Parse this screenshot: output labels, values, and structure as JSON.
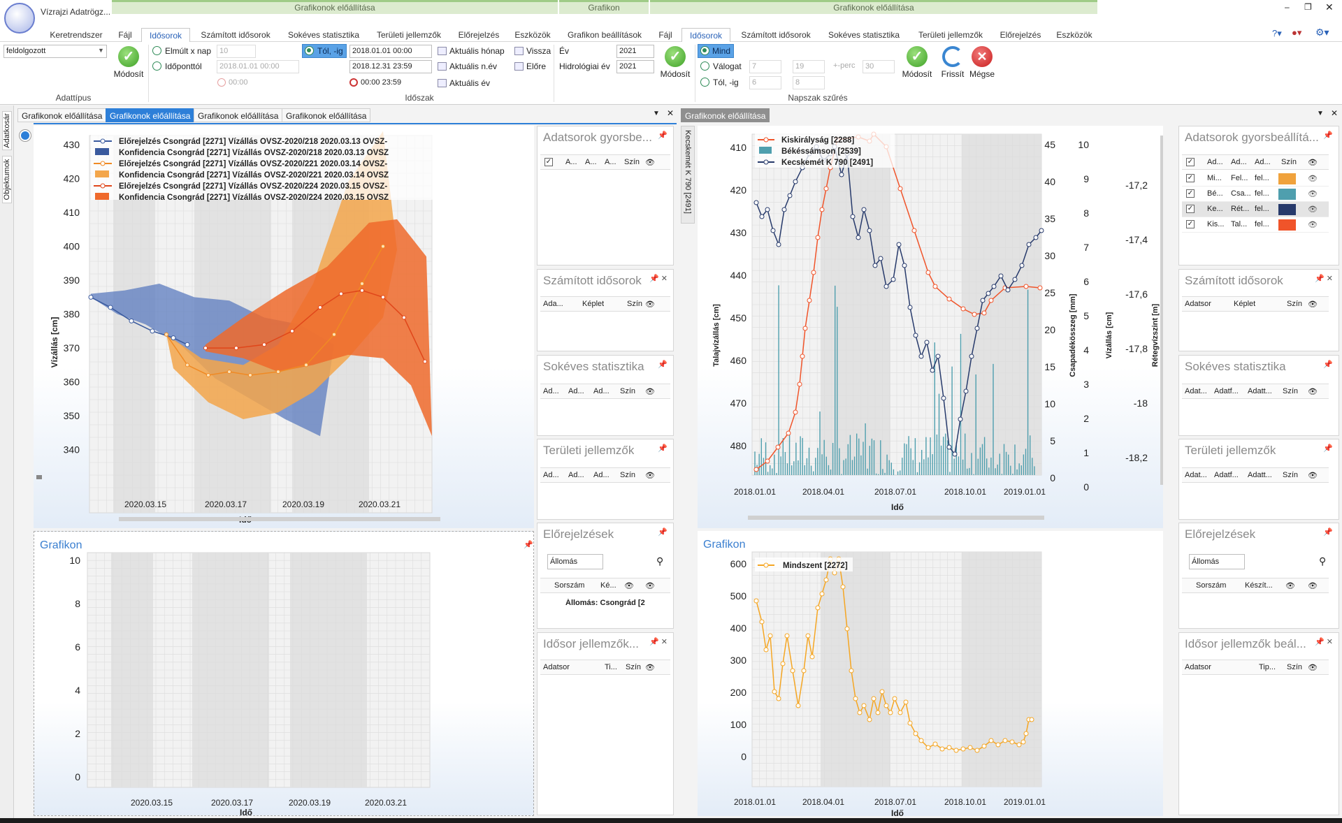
{
  "app": {
    "title": "Vízrajzi Adatrögz..."
  },
  "context_groups": [
    "Grafikonok előállítása",
    "Grafikon",
    "Grafikonok előállítása"
  ],
  "tabs_left": [
    "Keretrendszer",
    "Fájl",
    "Idősorok",
    "Számított idősorok",
    "Sokéves statisztika",
    "Területi jellemzők",
    "Előrejelzés",
    "Eszközök"
  ],
  "tabs_mid": [
    "Grafikon beállítások"
  ],
  "tabs_right": [
    "Fájl",
    "Idősorok",
    "Számított idősorok",
    "Sokéves statisztika",
    "Területi jellemzők",
    "Előrejelzés",
    "Eszközök"
  ],
  "ribbon": {
    "adattipus_value": "feldolgozott",
    "modosit": "Módosít",
    "group_adattipus": "Adattípus",
    "elmult_x_nap": "Elmúlt x nap",
    "elmult_value": "10",
    "idoponttol": "Időponttól",
    "idoponttol_value": "2018.01.01 00:00",
    "time_disabled": "00:00",
    "tol_ig": "Tól, -ig",
    "from_value": "2018.01.01 00:00",
    "to_value": "2018.12.31 23:59",
    "time_to": "00:00 23:59",
    "aktualis_honap": "Aktuális hónap",
    "aktualis_nev": "Aktuális n.év",
    "aktualis_ev": "Aktuális év",
    "vissza": "Vissza",
    "elore": "Előre",
    "group_idoszak": "Időszak",
    "ev": "Év",
    "ev_value": "2021",
    "hidro_ev": "Hidrológiai év",
    "hidro_value": "2021",
    "mind": "Mind",
    "valogat": "Válogat",
    "tol_ig2": "Tól, -ig",
    "val1": "7",
    "val2": "19",
    "perc_label": "+-perc",
    "perc_value": "30",
    "val3": "6",
    "val4": "8",
    "group_napszak": "Napszak szűrés",
    "frissit": "Frissít",
    "megse": "Mégse"
  },
  "side_tabs": [
    "Adatkosár",
    "Objektumok"
  ],
  "doc_tabs_left": [
    "Grafikonok előállítása",
    "Grafikonok előállítása",
    "Grafikonok előállítása",
    "Grafikonok előállítása"
  ],
  "doc_tabs_right": [
    "Grafikonok előállítása"
  ],
  "right_vertical_label": "Kecskemét K 790 [2491]",
  "chart1": {
    "legend": [
      "Előrejelzés Csongrád [2271] Vízállás OVSZ-2020/218 2020.03.13 OVSZ-",
      "Konfidencia Csongrád [2271] Vízállás OVSZ-2020/218 2020.03.13 OVSZ",
      "Előrejelzés Csongrád [2271] Vízállás OVSZ-2020/221 2020.03.14 OVSZ-",
      "Konfidencia Csongrád [2271] Vízállás OVSZ-2020/221 2020.03.14 OVSZ",
      "Előrejelzés Csongrád [2271] Vízállás OVSZ-2020/224 2020.03.15 OVSZ-",
      "Konfidencia Csongrád [2271] Vízállás OVSZ-2020/224 2020.03.15 OVSZ"
    ],
    "yticks": [
      "430",
      "420",
      "410",
      "400",
      "390",
      "380",
      "370",
      "360",
      "350",
      "340"
    ],
    "xticks": [
      "2020.03.15",
      "2020.03.17",
      "2020.03.19",
      "2020.03.21"
    ],
    "ylabel": "Vízállás [cm]",
    "xlabel": "Idő"
  },
  "chart2": {
    "title": "Grafikon",
    "yticks": [
      "10",
      "8",
      "6",
      "4",
      "2",
      "0"
    ],
    "xticks": [
      "2020.03.15",
      "2020.03.17",
      "2020.03.19",
      "2020.03.21"
    ],
    "xlabel": "Idő"
  },
  "chart3": {
    "legend": [
      "Kiskirályság [2288]",
      "Békéssámson [2539]",
      "Kecskemét K 790 [2491]"
    ],
    "y1ticks": [
      "410",
      "420",
      "430",
      "440",
      "450",
      "460",
      "470",
      "480"
    ],
    "y2ticks": [
      "45",
      "40",
      "35",
      "30",
      "25",
      "20",
      "15",
      "10",
      "5",
      "0"
    ],
    "y3ticks": [
      "10",
      "9",
      "8",
      "7",
      "6",
      "5",
      "4",
      "3",
      "2",
      "1",
      "0"
    ],
    "y4ticks": [
      "-17,2",
      "-17,4",
      "-17,6",
      "-17,8",
      "-18",
      "-18,2"
    ],
    "y1label": "Talajvízállás [cm]",
    "y2label": "Csapadékösszeg [mm]",
    "y3label": "Vízállás [cm]",
    "y4label": "Rétegvízszint [m]",
    "xticks": [
      "2018.01.01",
      "2018.04.01",
      "2018.07.01",
      "2018.10.01",
      "2019.01.01"
    ],
    "xlabel": "Idő"
  },
  "chart4": {
    "title": "Grafikon",
    "legend": [
      "Mindszent [2272]"
    ],
    "yticks": [
      "600",
      "500",
      "400",
      "300",
      "200",
      "100",
      "0"
    ],
    "xticks": [
      "2018.01.01",
      "2018.04.01",
      "2018.07.01",
      "2018.10.01",
      "2019.01.01"
    ],
    "xlabel": "Idő"
  },
  "side_left": {
    "gyors_title": "Adatsorok gyorsbe...",
    "gyors_cols": [
      "A...",
      "A...",
      "A...",
      "Szín"
    ],
    "szamitott_title": "Számított idősorok",
    "szamitott_cols": [
      "Ada...",
      "Képlet",
      "Szín"
    ],
    "sokeves_title": "Sokéves statisztika",
    "sokeves_cols": [
      "Ad...",
      "Ad...",
      "Ad...",
      "Szín"
    ],
    "teruleti_title": "Területi jellemzők",
    "teruleti_cols": [
      "Ad...",
      "Ad...",
      "Ad...",
      "Szín"
    ],
    "elorejelzes_title": "Előrejelzések",
    "allomas": "Állomás",
    "sorszam_cols": [
      "Sorszám",
      "Ké..."
    ],
    "group_row": "Állomás: Csongrád [2",
    "idosor_title": "Idősor jellemzők...",
    "idosor_cols": [
      "Adatsor",
      "Ti...",
      "Szín"
    ]
  },
  "side_right": {
    "gyors_title": "Adatsorok gyorsbeállítá...",
    "gyors_cols": [
      "Ad...",
      "Ad...",
      "Ad...",
      "Szín"
    ],
    "gyors_rows": [
      {
        "a": "Mi...",
        "b": "Fel...",
        "c": "fel...",
        "color": "#f0a23c"
      },
      {
        "a": "Bé...",
        "b": "Csa...",
        "c": "fel...",
        "color": "#4f9fae"
      },
      {
        "a": "Ke...",
        "b": "Rét...",
        "c": "fel...",
        "color": "#273a6b"
      },
      {
        "a": "Kis...",
        "b": "Tal...",
        "c": "fel...",
        "color": "#f0542a"
      }
    ],
    "szamitott_title": "Számított idősorok",
    "szamitott_cols": [
      "Adatsor",
      "Képlet",
      "Szín"
    ],
    "sokeves_title": "Sokéves statisztika",
    "sokeves_cols": [
      "Adat...",
      "Adatf...",
      "Adatt...",
      "Szín"
    ],
    "teruleti_title": "Területi jellemzők",
    "teruleti_cols": [
      "Adat...",
      "Adatf...",
      "Adatt...",
      "Szín"
    ],
    "elorejelzes_title": "Előrejelzések",
    "allomas": "Állomás",
    "sorszam_cols": [
      "Sorszám",
      "Készít..."
    ],
    "idosor_title": "Idősor jellemzők beál...",
    "idosor_cols": [
      "Adatsor",
      "Tip...",
      "Szín"
    ]
  }
}
